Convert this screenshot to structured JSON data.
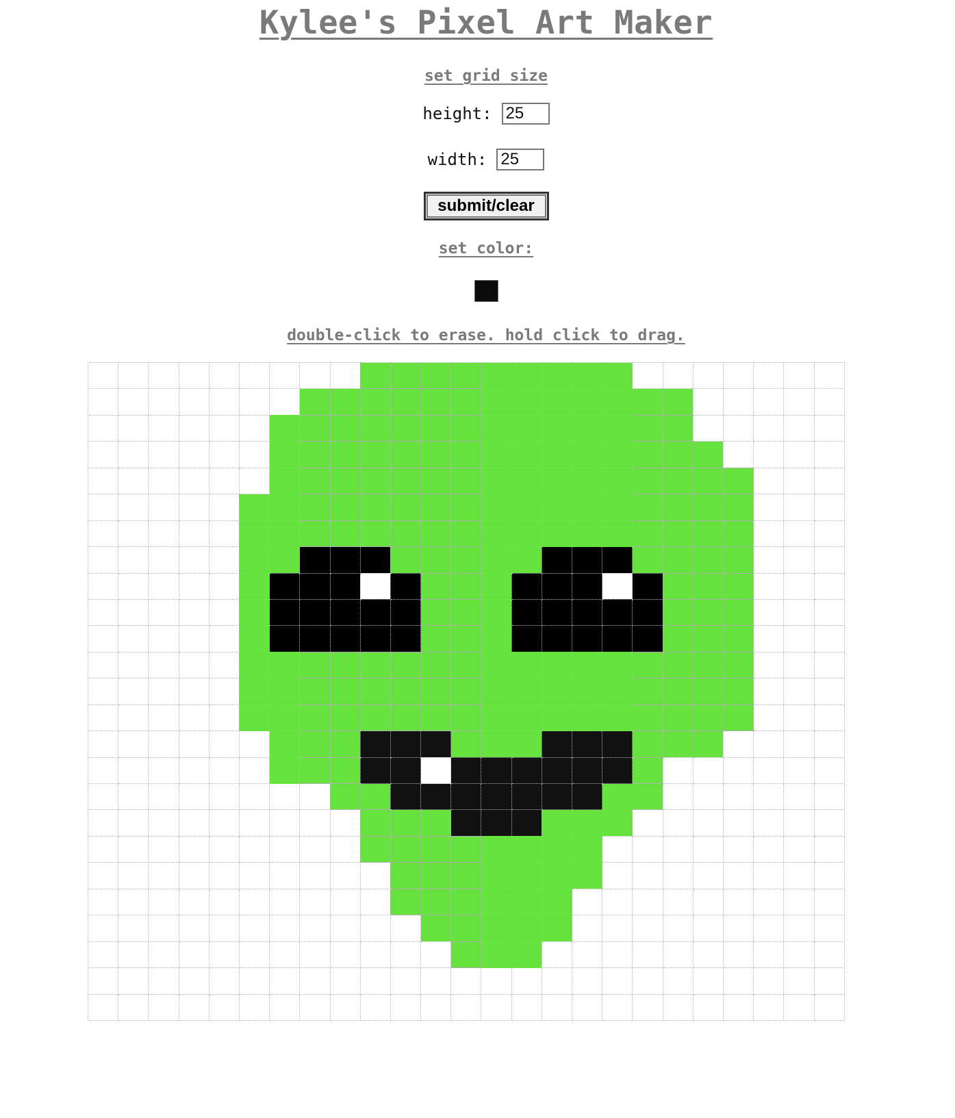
{
  "title": "Kylee's Pixel Art Maker",
  "grid_size": {
    "heading": "set grid size",
    "height_label": "height:",
    "height_value": "25",
    "width_label": "width:",
    "width_value": "25"
  },
  "submit_label": "submit/clear",
  "color": {
    "heading": "set color:",
    "value": "#0a0a0a"
  },
  "hint": "double-click to erase. hold click to drag.",
  "palette": {
    "G": "#66e23f",
    "B": "#000000",
    "D": "#111111",
    "W": "#ffffff",
    "E": "#ffffff"
  },
  "pixels": [
    ".........GGGGGGGGG.......",
    ".......GGGGGGGGGGGGG.....",
    "......GGGGGGGGGGGGGG.....",
    "......GGGGGGGGGGGGGGG....",
    "......GGGGGGGGGGGGGGGG...",
    ".....GGGGGGGGGGGGGGGGG...",
    ".....GGGGGGGGGGGGGGGGG...",
    ".....GGBBBGGGGGBBBGGGG...",
    ".....GBBBWBGGGBBBWBGGG...",
    ".....GBBBBBGGGBBBBBGGG...",
    ".....GBBBBBGGGBBBBBGGG...",
    ".....GGGGGGGGGGGGGGGGG...",
    ".....GGGGGGGGGGGGGGGGG...",
    ".....GGGGGGGGGGGGGGGGG...",
    "......GGGDDDGGGDDDGGG....",
    "......GGGDDWDDDDDDG......",
    "........GGDDDDDDDGG......",
    ".........GGGDDDGGG.......",
    ".........GGGGGGGG........",
    "..........GGGGGGG........",
    "..........GGGGGG.........",
    "...........GGGGG.........",
    "............GGG..........",
    ".........................",
    "........................."
  ]
}
